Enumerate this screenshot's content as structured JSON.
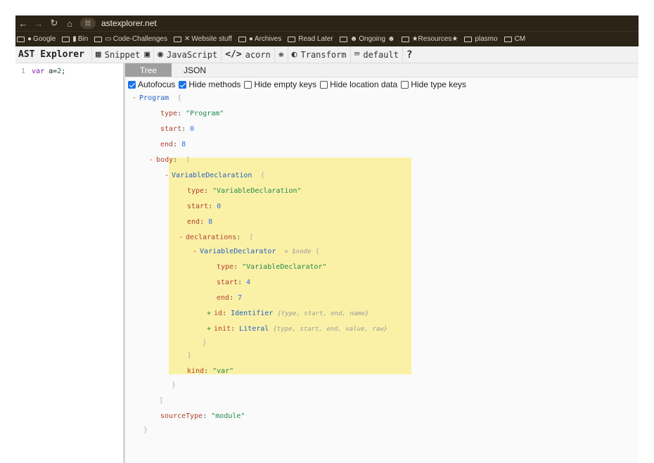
{
  "browser": {
    "url": "astexplorer.net",
    "bookmarks": [
      {
        "label": "Google",
        "icon": "search-icon"
      },
      {
        "label": "Bin",
        "icon": "trash-icon"
      },
      {
        "label": "Code-Challenges",
        "icon": "laptop-icon"
      },
      {
        "label": "Website stuff",
        "icon": "tools-icon"
      },
      {
        "label": "Archives",
        "icon": "emoji-icon"
      },
      {
        "label": "Read Later",
        "icon": "folder-icon"
      },
      {
        "label": "Ongoing",
        "icon": "people-icon"
      },
      {
        "label": "★Resources★",
        "icon": "folder-icon"
      },
      {
        "label": "plasmo",
        "icon": "folder-icon"
      },
      {
        "label": "CM",
        "icon": "folder-icon"
      }
    ]
  },
  "toolbar": {
    "title": "AST Explorer",
    "snippet": "Snippet",
    "language": "JavaScript",
    "parser": "acorn",
    "transform": "Transform",
    "keymap": "default",
    "help": "?"
  },
  "editor": {
    "lines": [
      {
        "number": "1",
        "keyword": "var",
        "identifier": "a",
        "operator": "=",
        "value": "2",
        "end": ";"
      }
    ]
  },
  "output": {
    "tabs": [
      {
        "label": "Tree",
        "active": true
      },
      {
        "label": "JSON",
        "active": false
      }
    ],
    "options": [
      {
        "label": "Autofocus",
        "checked": true
      },
      {
        "label": "Hide methods",
        "checked": true
      },
      {
        "label": "Hide empty keys",
        "checked": false
      },
      {
        "label": "Hide location data",
        "checked": false
      },
      {
        "label": "Hide type keys",
        "checked": false
      }
    ]
  },
  "tree": {
    "program": {
      "toggle": "-",
      "name": "Program",
      "open": "{",
      "close": "}"
    },
    "program_type": {
      "key": "type",
      "value": "\"Program\""
    },
    "program_start": {
      "key": "start",
      "value": "0"
    },
    "program_end": {
      "key": "end",
      "value": "8"
    },
    "body": {
      "toggle": "-",
      "key": "body",
      "open": "[",
      "close": "]"
    },
    "vardecl": {
      "toggle": "-",
      "name": "VariableDeclaration",
      "open": "{",
      "close": "}"
    },
    "vardecl_type": {
      "key": "type",
      "value": "\"VariableDeclaration\""
    },
    "vardecl_start": {
      "key": "start",
      "value": "0"
    },
    "vardecl_end": {
      "key": "end",
      "value": "8"
    },
    "declarations": {
      "toggle": "-",
      "key": "declarations",
      "open": "[",
      "close": "]"
    },
    "declarator": {
      "toggle": "-",
      "name": "VariableDeclarator",
      "meta": "= $node",
      "open": "{",
      "close": "}"
    },
    "declarator_type": {
      "key": "type",
      "value": "\"VariableDeclarator\""
    },
    "declarator_start": {
      "key": "start",
      "value": "4"
    },
    "declarator_end": {
      "key": "end",
      "value": "7"
    },
    "id": {
      "toggle": "+",
      "key": "id",
      "name": "Identifier",
      "summary": "{type, start, end, name}"
    },
    "init": {
      "toggle": "+",
      "key": "init",
      "name": "Literal",
      "summary": "{type, start, end, value, raw}"
    },
    "kind": {
      "key": "kind",
      "value": "\"var\""
    },
    "source_type": {
      "key": "sourceType",
      "value": "\"module\""
    }
  }
}
